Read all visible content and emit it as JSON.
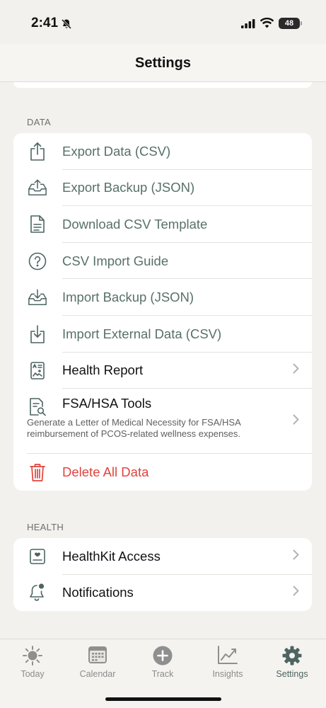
{
  "status": {
    "time": "2:41",
    "battery": "48"
  },
  "nav": {
    "title": "Settings"
  },
  "data_section": {
    "header": "DATA",
    "items": [
      {
        "label": "Export Data (CSV)"
      },
      {
        "label": "Export Backup (JSON)"
      },
      {
        "label": "Download CSV Template"
      },
      {
        "label": "CSV Import Guide"
      },
      {
        "label": "Import Backup (JSON)"
      },
      {
        "label": "Import External Data (CSV)"
      },
      {
        "label": "Health Report"
      },
      {
        "label": "FSA/HSA Tools",
        "description": "Generate a Letter of Medical Necessity for FSA/HSA reimbursement of PCOS-related wellness expenses."
      },
      {
        "label": "Delete All Data"
      }
    ]
  },
  "health_section": {
    "header": "HEALTH",
    "items": [
      {
        "label": "HealthKit Access"
      },
      {
        "label": "Notifications"
      }
    ]
  },
  "tabs": [
    {
      "label": "Today",
      "icon": "sun-icon"
    },
    {
      "label": "Calendar",
      "icon": "calendar-icon"
    },
    {
      "label": "Track",
      "icon": "plus-circle-icon"
    },
    {
      "label": "Insights",
      "icon": "chart-line-icon"
    },
    {
      "label": "Settings",
      "icon": "gear-icon",
      "active": true
    }
  ],
  "colors": {
    "accent": "#4d6461",
    "destructive": "#e0443c",
    "background": "#f2f1ed"
  }
}
